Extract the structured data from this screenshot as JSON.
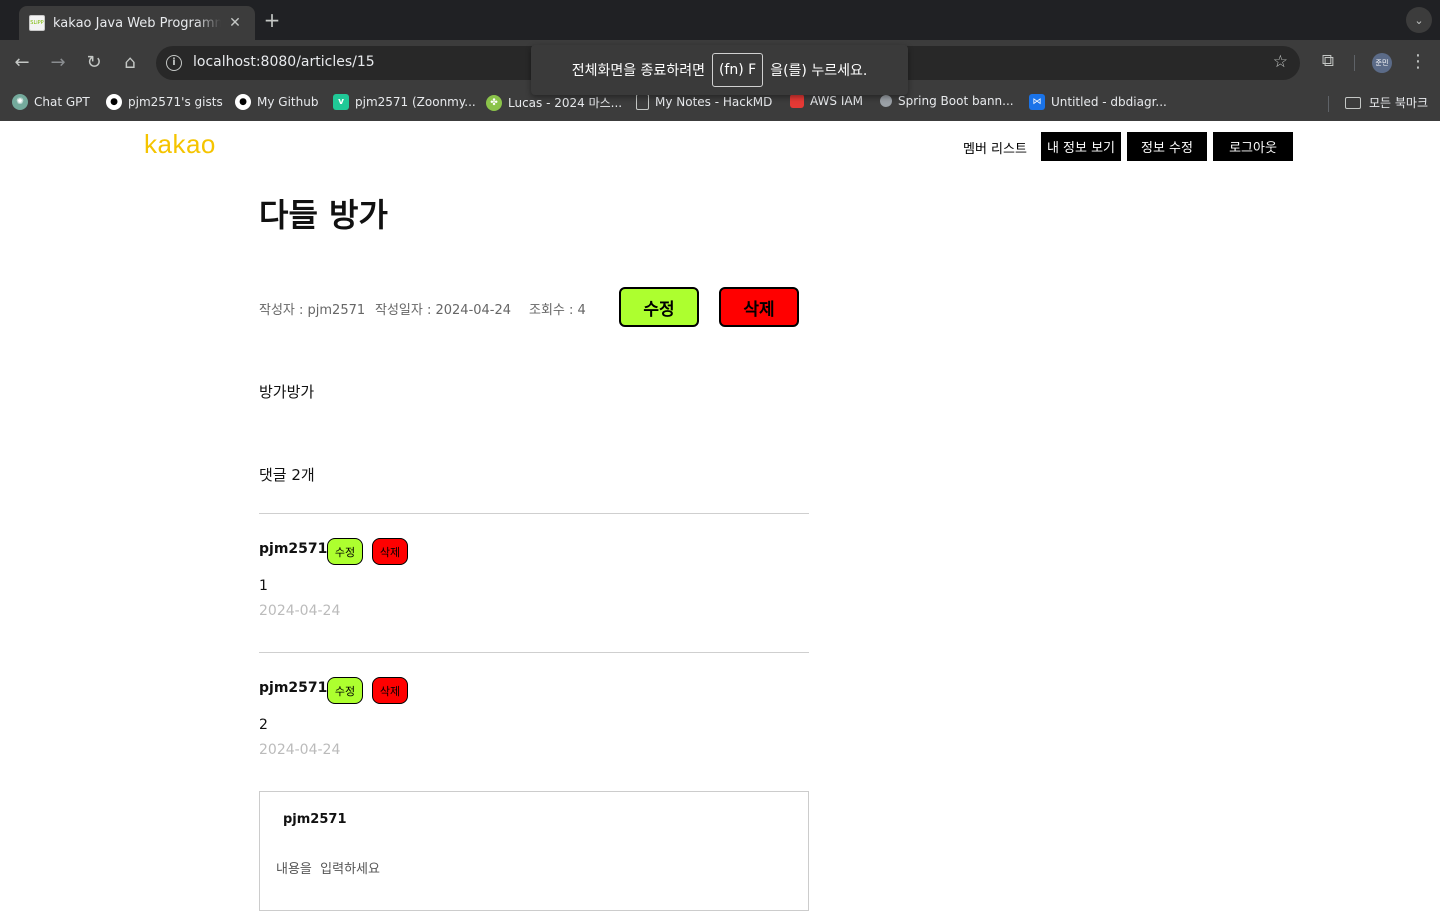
{
  "browser": {
    "tab_title": "kakao Java Web Programming",
    "tab_favicon_text": "SLiPP",
    "url": "localhost:8080/articles/15",
    "fullscreen_prefix": "전체화면을 종료하려면",
    "fullscreen_key": "(fn) F",
    "fullscreen_suffix": "을(를) 누르세요.",
    "profile_initials": "준민",
    "bookmarks": [
      {
        "label": "Chat GPT",
        "color": "#74aa9c"
      },
      {
        "label": "pjm2571's gists",
        "color": "#ffffff"
      },
      {
        "label": "My Github",
        "color": "#ffffff"
      },
      {
        "label": "pjm2571 (Zoonmy...",
        "color": "#20c997"
      },
      {
        "label": "Lucas - 2024 마스...",
        "color": "#8bc34a"
      },
      {
        "label": "My Notes - HackMD",
        "color": "#9e9e9e"
      },
      {
        "label": "AWS IAM",
        "color": "#e53935"
      },
      {
        "label": "Spring Boot bann...",
        "color": "#9aa0a6"
      },
      {
        "label": "Untitled - dbdiagr...",
        "color": "#1a73e8"
      }
    ],
    "all_bookmarks": "모든 북마크"
  },
  "header": {
    "logo": "kakao",
    "member_list": "멤버 리스트",
    "my_info": "내 정보 보기",
    "edit_info": "정보 수정",
    "logout": "로그아웃"
  },
  "article": {
    "title": "다들 방가",
    "author_label": "작성자 : pjm2571",
    "date_label": "작성일자 : 2024-04-24",
    "views_label": "조회수 : 4",
    "edit_button": "수정",
    "delete_button": "삭제",
    "content": "방가방가",
    "comment_count": "댓글 2개"
  },
  "comments": [
    {
      "author": "pjm2571",
      "text": "1",
      "date": "2024-04-24",
      "edit": "수정",
      "delete": "삭제"
    },
    {
      "author": "pjm2571",
      "text": "2",
      "date": "2024-04-24",
      "edit": "수정",
      "delete": "삭제"
    }
  ],
  "comment_form": {
    "author": "pjm2571",
    "placeholder": "내용을  입력하세요"
  }
}
